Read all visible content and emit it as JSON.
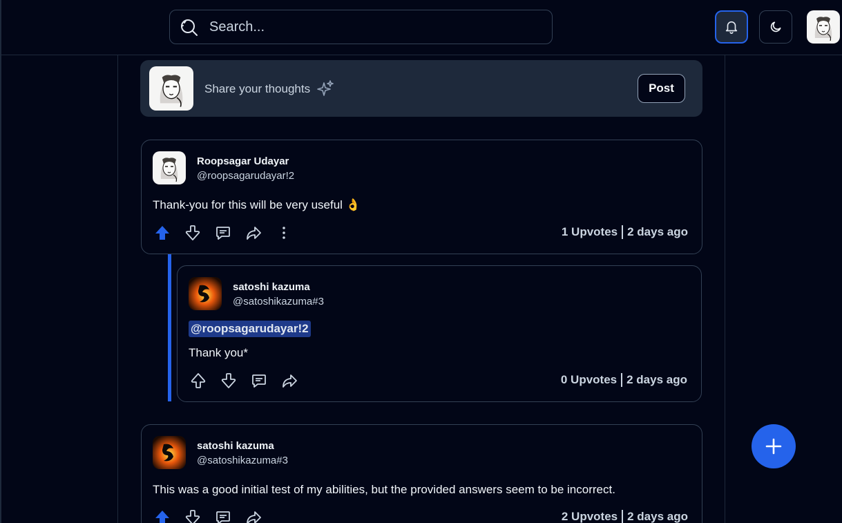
{
  "header": {
    "search_placeholder": "Search...",
    "icons": [
      "search-icon",
      "bell-icon",
      "moon-icon",
      "avatar"
    ]
  },
  "composer": {
    "prompt": "Share your thoughts",
    "post_label": "Post"
  },
  "posts": [
    {
      "author": "Roopsagar Udayar",
      "handle": "@roopsagarudayar!2",
      "body": "Thank-you for this will be very useful 👌",
      "upvotes": "1 Upvotes",
      "time": "2 days ago",
      "upvoted": true,
      "replies": [
        {
          "author": "satoshi kazuma",
          "handle": "@satoshikazuma#3",
          "mention": "@roopsagarudayar!2",
          "body": "Thank you*",
          "upvotes": "0 Upvotes",
          "time": "2 days ago",
          "upvoted": false
        }
      ]
    },
    {
      "author": "satoshi kazuma",
      "handle": "@satoshikazuma#3",
      "body": "This was a good initial test of my abilities, but the provided answers seem to be incorrect.",
      "upvotes": "2 Upvotes",
      "time": "2 days ago",
      "upvoted": true
    }
  ],
  "colors": {
    "background": "#020617",
    "accent": "#2563eb",
    "card_border": "#334155",
    "composer_bg": "#1e293b"
  }
}
